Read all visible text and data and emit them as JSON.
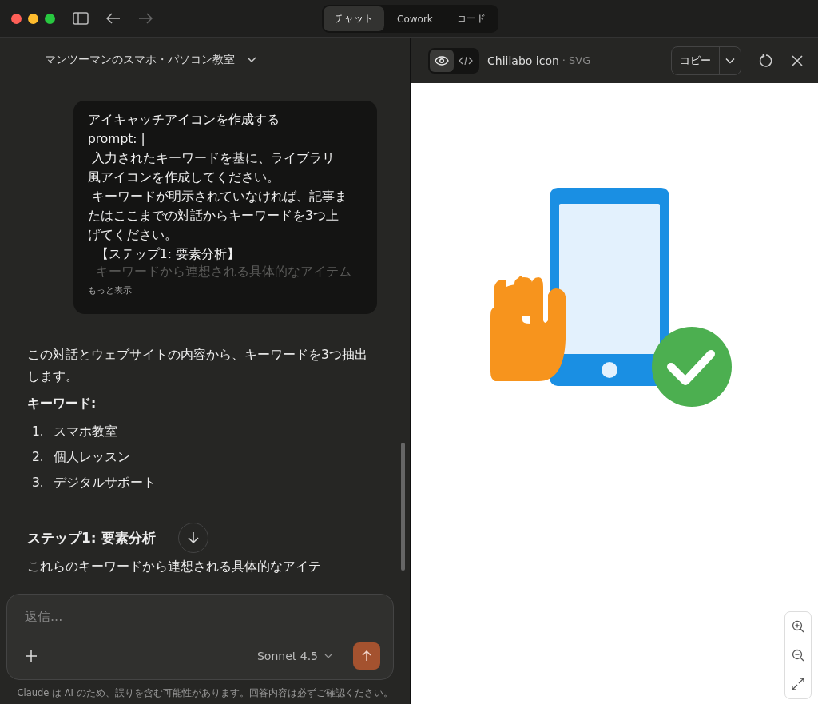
{
  "window": {
    "tabs": [
      {
        "label": "チャット",
        "selected": true
      },
      {
        "label": "Cowork",
        "selected": false
      },
      {
        "label": "コード",
        "selected": false
      }
    ]
  },
  "chat": {
    "project_title": "マンツーマンのスマホ・パソコン教室",
    "user_message": {
      "lines": [
        "アイキャッチアイコンを作成する",
        "prompt: |",
        " 入力されたキーワードを基に、ライブラリ",
        "風アイコンを作成してください。",
        " キーワードが明示されていなければ、記事ま",
        "たはここまでの対話からキーワードを3つ上",
        "げてください。",
        "  【ステップ1: 要素分析】",
        "  キーワードから連想される具体的なアイテム"
      ],
      "show_more": "もっと表示"
    },
    "response": {
      "intro": "この対話とウェブサイトの内容から、キーワードを3つ抽出します。",
      "keywords_label": "キーワード:",
      "keywords": [
        {
          "number": "1.",
          "text": "スマホ教室"
        },
        {
          "number": "2.",
          "text": "個人レッスン"
        },
        {
          "number": "3.",
          "text": "デジタルサポート"
        }
      ],
      "heading": "ステップ1: 要素分析",
      "partial": "これらのキーワードから連想される具体的なアイテ"
    },
    "composer": {
      "placeholder": "返信...",
      "model": "Sonnet 4.5"
    },
    "disclaimer": "Claude は AI のため、誤りを含む可能性があります。回答内容は必ずご確認ください。"
  },
  "artifact": {
    "views": [
      {
        "kind": "preview",
        "selected": true
      },
      {
        "kind": "code",
        "selected": false
      }
    ],
    "title": "Chiilabo icon",
    "type": "· SVG",
    "copy_label": "コピー"
  }
}
